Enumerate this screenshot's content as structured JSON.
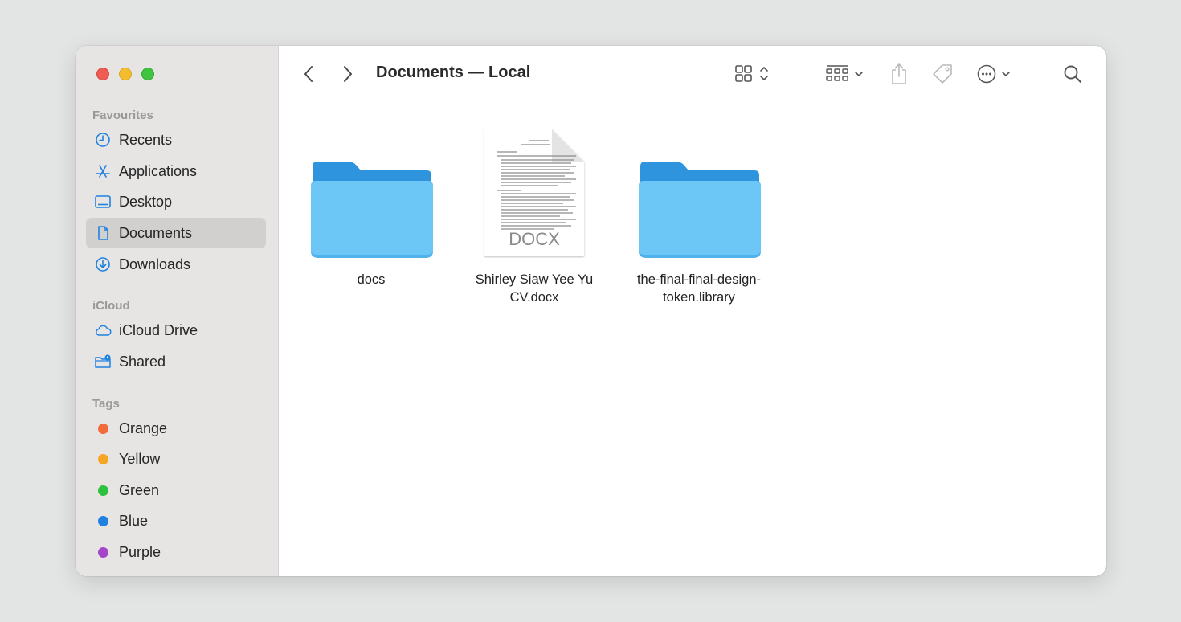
{
  "window": {
    "title": "Documents — Local"
  },
  "sidebar": {
    "sections": [
      {
        "label": "Favourites"
      },
      {
        "label": "iCloud"
      },
      {
        "label": "Tags"
      }
    ],
    "favourites": [
      {
        "label": "Recents",
        "icon": "clock-icon"
      },
      {
        "label": "Applications",
        "icon": "applications-icon"
      },
      {
        "label": "Desktop",
        "icon": "desktop-icon"
      },
      {
        "label": "Documents",
        "icon": "document-icon",
        "selected": true
      },
      {
        "label": "Downloads",
        "icon": "download-icon"
      }
    ],
    "icloud": [
      {
        "label": "iCloud Drive",
        "icon": "cloud-icon"
      },
      {
        "label": "Shared",
        "icon": "shared-folder-icon"
      }
    ],
    "tags": [
      {
        "label": "Orange",
        "color": "#f26c3b"
      },
      {
        "label": "Yellow",
        "color": "#f5a623"
      },
      {
        "label": "Green",
        "color": "#2ec13f"
      },
      {
        "label": "Blue",
        "color": "#1f82e0"
      },
      {
        "label": "Purple",
        "color": "#a346c7"
      }
    ]
  },
  "files": [
    {
      "name_line1": "docs",
      "name_line2": "",
      "type": "folder"
    },
    {
      "name_line1": "Shirley Siaw Yee Yu",
      "name_line2": "CV.docx",
      "type": "docx",
      "badge": "DOCX"
    },
    {
      "name_line1": "the-final-final-design-",
      "name_line2": "token.library",
      "type": "folder"
    }
  ],
  "colors": {
    "folder_back": "#2e94dd",
    "folder_front": "#6cc6f6",
    "accent": "#1f82e0"
  }
}
